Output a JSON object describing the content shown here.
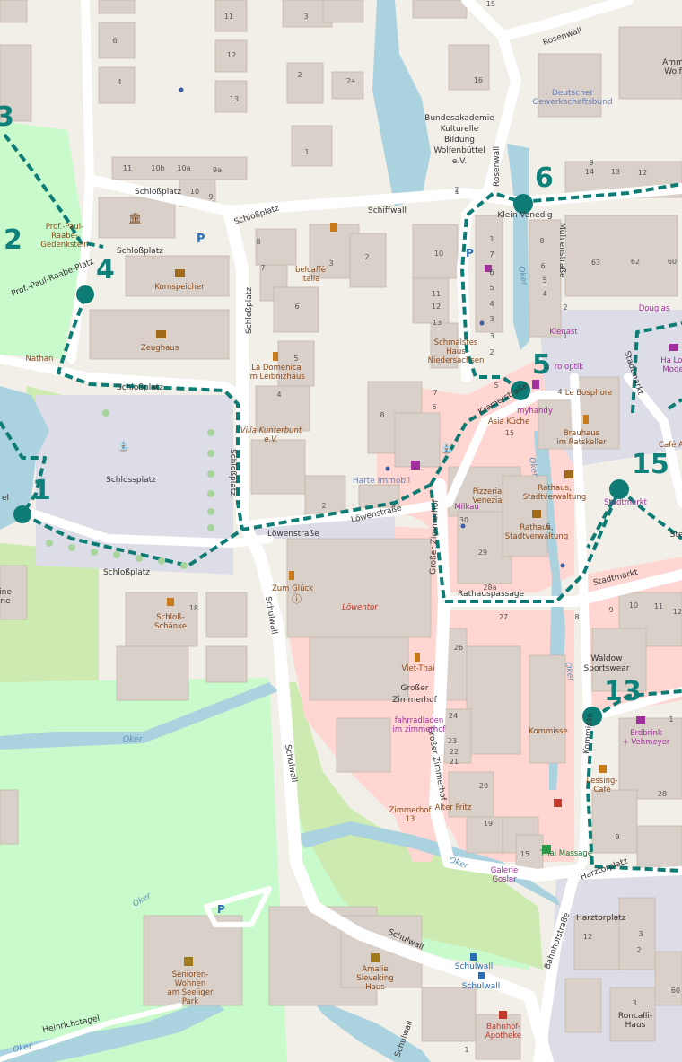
{
  "colors": {
    "background": "#f2efe9",
    "water": "#aad3df",
    "park": "#c8facc",
    "grass": "#cdebb0",
    "building": "#d9d0c9",
    "pedestrian": "#dddde8",
    "retail": "#ffd6d1",
    "route": "#0e7c74",
    "stop_marker": "#0e7c74"
  },
  "stops": [
    {
      "id": "stop-1",
      "label": "1"
    },
    {
      "id": "stop-2",
      "label": "2"
    },
    {
      "id": "stop-3",
      "label": "3"
    },
    {
      "id": "stop-4",
      "label": "4"
    },
    {
      "id": "stop-5",
      "label": "5"
    },
    {
      "id": "stop-6",
      "label": "6"
    },
    {
      "id": "stop-13",
      "label": "13"
    },
    {
      "id": "stop-15",
      "label": "15"
    }
  ],
  "streets": {
    "rosenwall": "Rosenwall",
    "schlossplatz_top": "Schloßplatz",
    "schiffwall": "Schiffwall",
    "schlossplatz_2": "Schloßplatz",
    "schlossplatz_vert": "Schloßplatz",
    "schlossplatz_3": "Schloßplatz",
    "schlossplatz_4": "Schloßplatz",
    "schlossplatz_5": "Schlossplatz",
    "prof_paul_raabe_platz": "Prof.-Paul-Raabe-Platz",
    "rosenwall_vert": "Rosenwall",
    "muehlenstrasse": "Mühlenstraße",
    "stadtmarkt": "Stadtmarkt",
    "stadtmarkt_2": "Stadtmarkt",
    "loewenstrasse": "Löwenstraße",
    "loewenstrasse_2": "Löwenstraße",
    "grosser_zimmerhof": "Großer Zimmerhof",
    "grosser_zimmerhof_2": "Großer Zimmerhof",
    "rathauspassage": "Rathauspassage",
    "schulwall": "Schulwall",
    "schulwall_2": "Schulwall",
    "schulwall_3": "Schulwall",
    "schulwall_4": "Schulwall",
    "kommisse_street": "Kommisse",
    "harztorplatz": "Harztorplatz",
    "harztorplatz_2": "Harztorplatz",
    "bahnhofstrasse": "Bahnhofstraße",
    "heinrichstagel": "Heinrichstagel",
    "kranichstrasse": "Kramerstraße",
    "sl_vert": "Schloßplatz"
  },
  "water_labels": [
    "Oker",
    "Oker",
    "Oker",
    "Oker",
    "Oker",
    "Oker",
    "Oker"
  ],
  "places": {
    "bundesakademie": [
      "Bundesakademie",
      "Kulturelle",
      "Bildung",
      "Wolfenbüttel",
      "e.V."
    ],
    "deutscher_gewerkschaftsbund": [
      "Deutscher",
      "Gewerkschaftsbund"
    ],
    "kornspeicher": "Kornspeicher",
    "zeughaus": "Zeughaus",
    "schlossplatz_place": "Schlossplatz",
    "nathan": "Nathan",
    "prof_paul_raabe_gedenk": [
      "Prof.-Paul-",
      "Raabe-",
      "Gedenkstein"
    ],
    "belcaffe": [
      "belcaffè",
      "italia"
    ],
    "la_domenica": [
      "La Domenica",
      "im Leibnizhaus"
    ],
    "villa_kunterbunt": [
      "Villa Kunterbunt",
      "e.V."
    ],
    "klein_venedig": "Klein Venedig",
    "schmalstes_haus": [
      "Schmalstes",
      "Haus",
      "Niedersachsen"
    ],
    "kienast": "Kienast",
    "optik": "ro optik",
    "myhandy": "myhandy",
    "le_bosphore": "Le Bosphore",
    "asia_kuche": "Asia Küche",
    "brauhaus": [
      "Brauhaus",
      "im Ratskeller"
    ],
    "rathaus1": [
      "Rathaus,",
      "Stadtverwaltung"
    ],
    "rathaus2": [
      "Rathaus,",
      "Stadtverwaltung"
    ],
    "harte_immobi": "Harte Immobil",
    "pizzeria": [
      "Pizzeria",
      "Venezia"
    ],
    "milkau": "Milkau",
    "stadtmarkt_poi": "Stadtmarkt",
    "douglas": "Douglas",
    "ha_lor": [
      "Ha Lor",
      "Mode"
    ],
    "cafe_a": "Café A",
    "zum_gluck": "Zum Glück",
    "lowentor": "Löwentor",
    "schloss_schanke": [
      "Schloß-",
      "Schänke"
    ],
    "viet_thai": "Viet-Thai",
    "grosser_zimmerhof_place": [
      "Großer",
      "Zimmerhof"
    ],
    "fahrradladen": [
      "fahrradladen",
      "im zimmerhof"
    ],
    "kommisse": "Kommisse",
    "waldow": [
      "Waldow",
      "Sportswear"
    ],
    "erdbrink": [
      "Erdbrink",
      "+ Vehmeyer"
    ],
    "lessing_cafe": [
      "Lessing-",
      "Café"
    ],
    "alter_fritz": "Alter Fritz",
    "zimmerhof13": [
      "Zimmerhof",
      "13"
    ],
    "thai_massage": "Thai Massage",
    "galerie_goslar": [
      "Galerie",
      "Goslar"
    ],
    "senioren": [
      "Senioren-",
      "Wohnen",
      "am Seeliger",
      "Park"
    ],
    "amalie": [
      "Amalie",
      "Sieveking",
      "Haus"
    ],
    "schulwall_stop1": "Schulwall",
    "schulwall_stop2": "Schulwall",
    "bahnhof_apotheke": [
      "Bahnhof-",
      "Apotheke"
    ],
    "roncalli": [
      "Roncalli-",
      "Haus"
    ],
    "amm_wolf": [
      "Amm",
      "Wolf"
    ],
    "liste": "Ste",
    "el": "el",
    "ine": [
      "ine",
      "ne"
    ],
    "u28a": "28a"
  },
  "house_numbers": [
    "11",
    "6",
    "12",
    "4",
    "13",
    "3",
    "2",
    "2a",
    "16",
    "15",
    "1",
    "11",
    "10b",
    "10a",
    "9a",
    "10",
    "9",
    "8",
    "7",
    "3",
    "6",
    "5",
    "4",
    "2",
    "10",
    "11",
    "12",
    "13",
    "3",
    "2",
    "1",
    "7",
    "6",
    "5",
    "4",
    "3",
    "2",
    "1",
    "8",
    "9",
    "6",
    "5",
    "4",
    "3",
    "2",
    "1",
    "14",
    "13",
    "12",
    "63",
    "62",
    "60",
    "6",
    "7",
    "8",
    "15",
    "5",
    "30",
    "29",
    "28a",
    "27",
    "26",
    "24",
    "23",
    "22",
    "21",
    "20",
    "19",
    "15",
    "10",
    "11",
    "12",
    "8",
    "9",
    "10",
    "1",
    "28",
    "9",
    "18",
    "12",
    "3",
    "60",
    "4",
    "2",
    "3",
    "1",
    "2",
    "6",
    "4",
    "6",
    "2",
    "7"
  ]
}
